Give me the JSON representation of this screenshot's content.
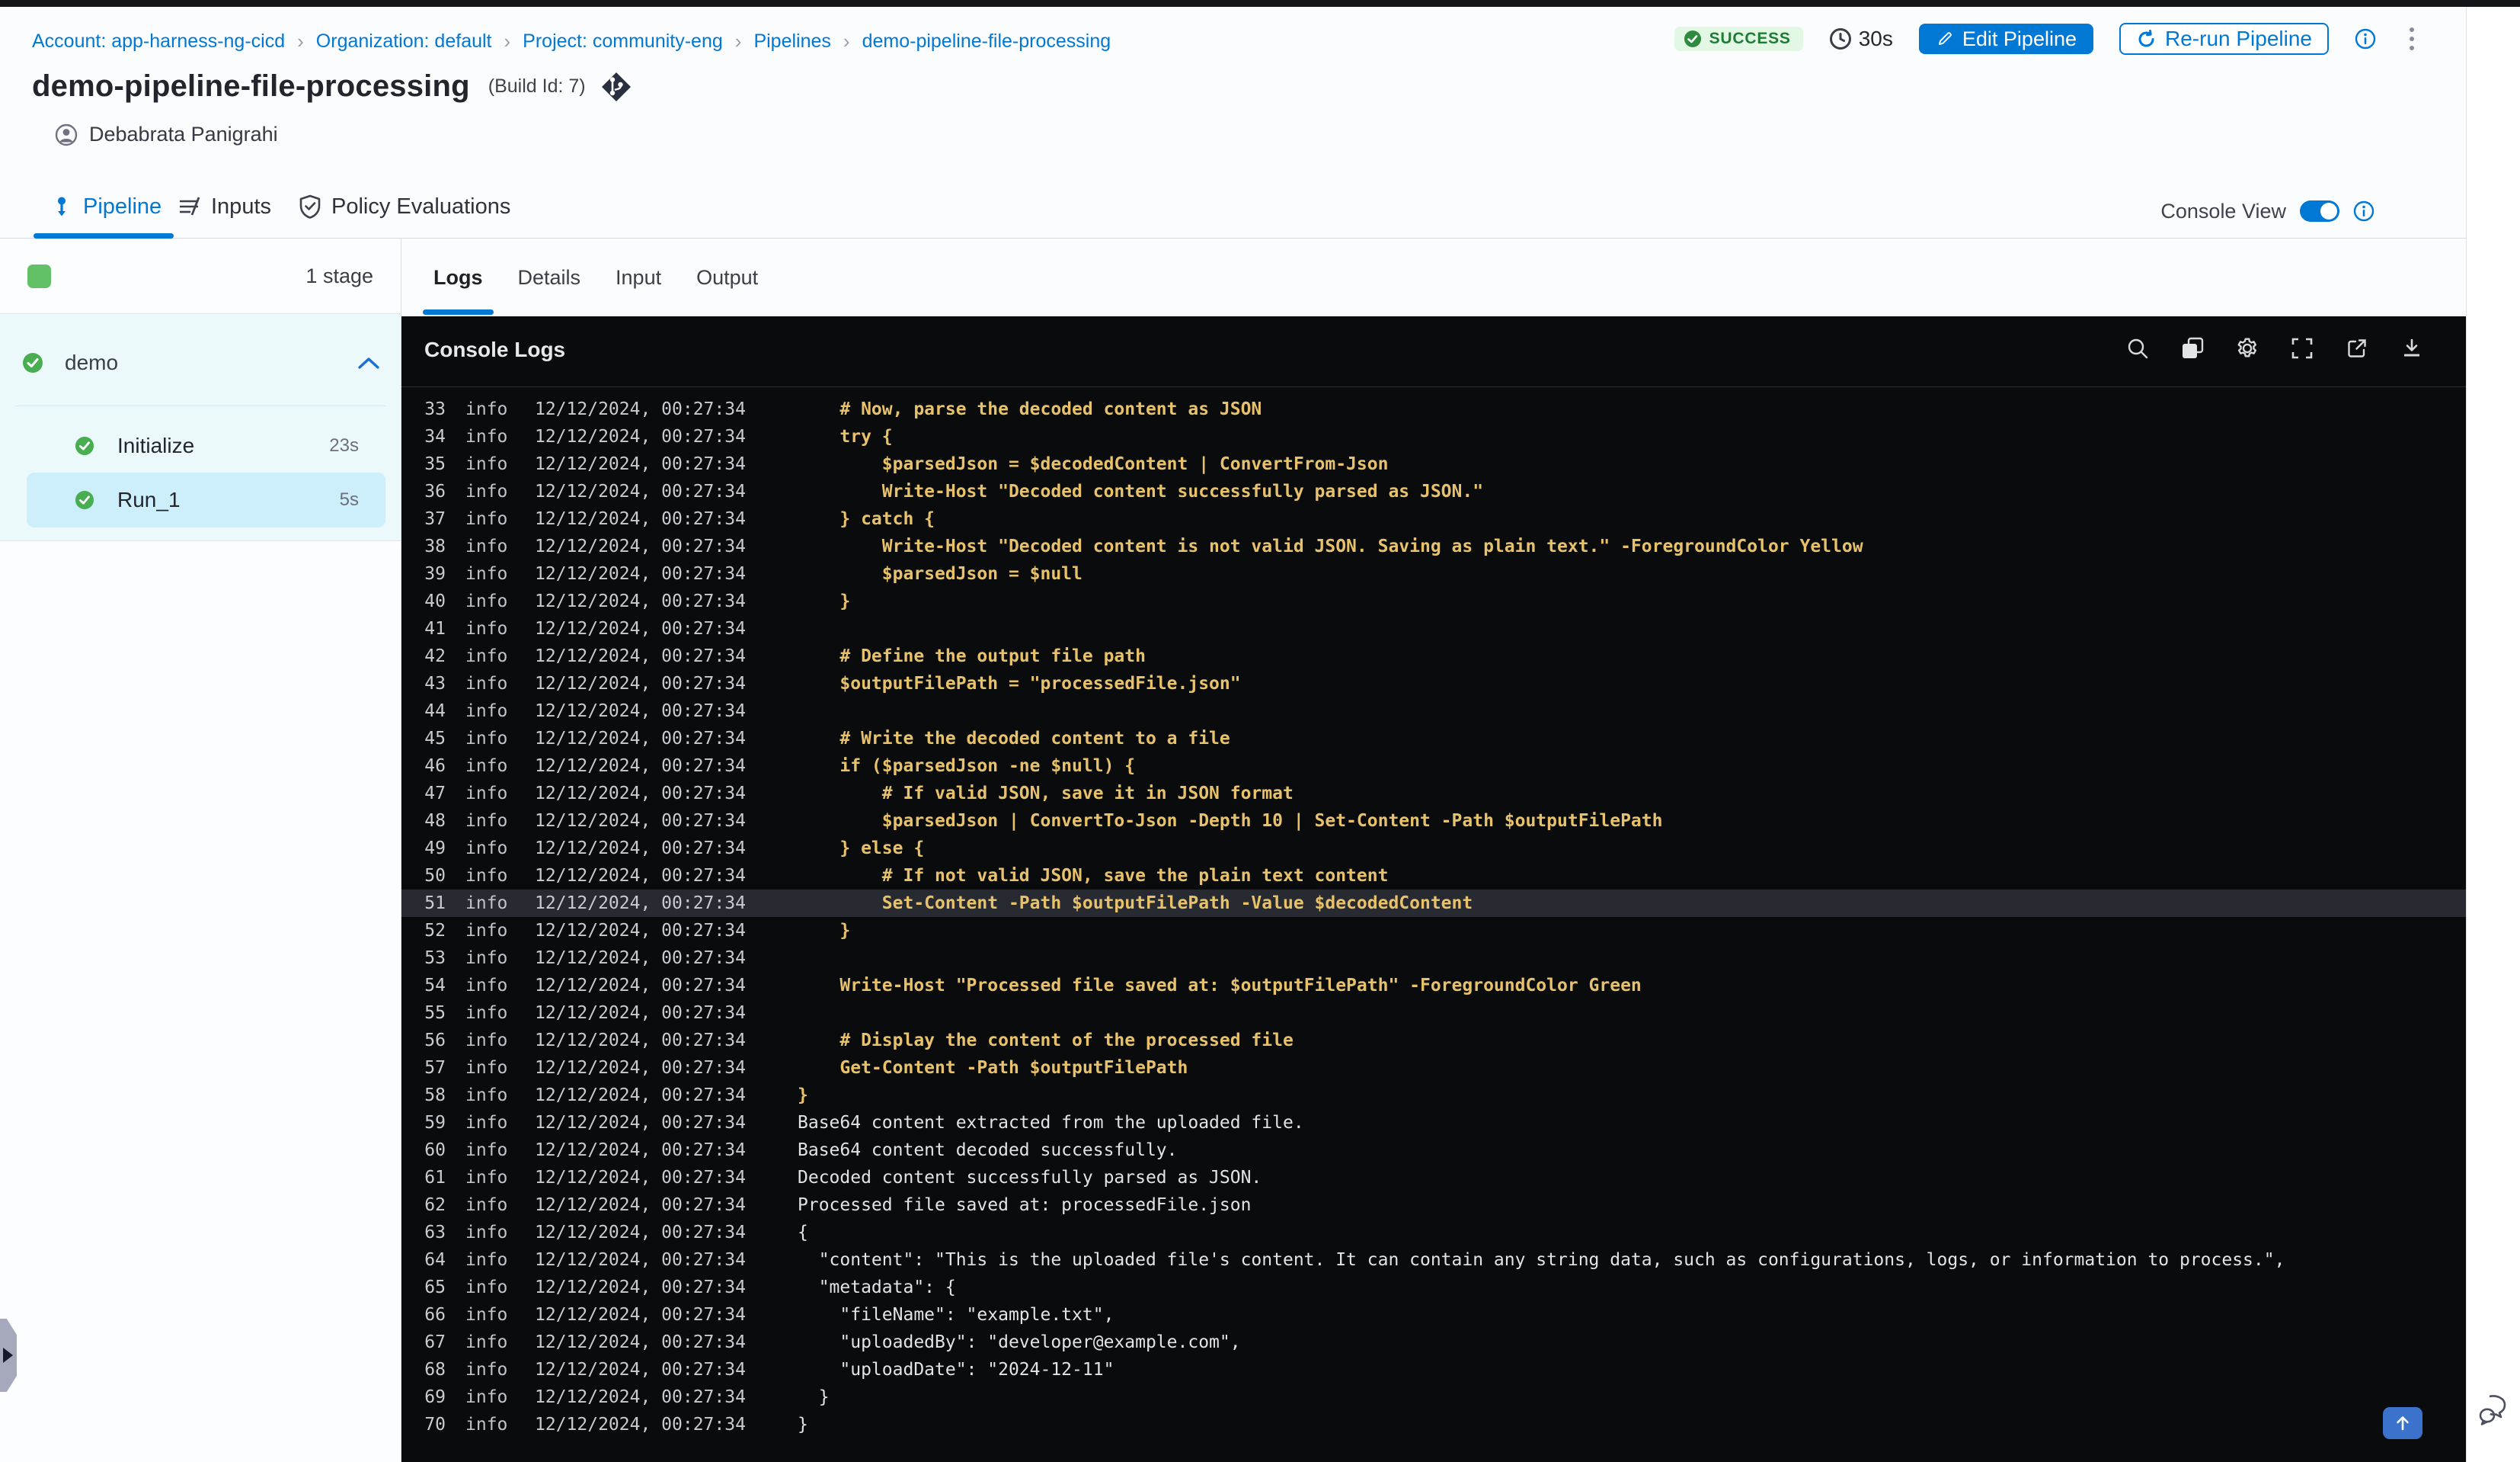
{
  "colors": {
    "accent_blue": "#0278d5",
    "success_green": "#4caf50",
    "badge_bg": "#e3f7e5",
    "badge_text": "#1e7d35",
    "console_bg": "#0a0b0d",
    "log_yellow": "#e8c26a",
    "log_white": "#e2e3e6",
    "stage_group_bg": "#ebf9fb",
    "selected_step_bg": "#cdeefb"
  },
  "breadcrumb": {
    "separator": "›",
    "items": [
      {
        "label": "Account: app-harness-ng-cicd"
      },
      {
        "label": "Organization: default"
      },
      {
        "label": "Project: community-eng"
      },
      {
        "label": "Pipelines"
      },
      {
        "label": "demo-pipeline-file-processing"
      }
    ]
  },
  "header": {
    "title": "demo-pipeline-file-processing",
    "build_id_label": "(Build Id: 7)",
    "author": "Debabrata Panigrahi",
    "status_label": "SUCCESS",
    "duration": "30s",
    "edit_button": "Edit Pipeline",
    "rerun_button": "Re-run Pipeline"
  },
  "main_tabs": [
    {
      "label": "Pipeline",
      "active": true
    },
    {
      "label": "Inputs",
      "active": false
    },
    {
      "label": "Policy Evaluations",
      "active": false
    }
  ],
  "console_view": {
    "label": "Console View",
    "enabled": true
  },
  "stage_panel": {
    "stage_count_label": "1 stage",
    "stage_name": "demo",
    "steps": [
      {
        "name": "Initialize",
        "duration": "23s",
        "status": "success",
        "selected": false
      },
      {
        "name": "Run_1",
        "duration": "5s",
        "status": "success",
        "selected": true
      }
    ]
  },
  "log_tabs": [
    {
      "label": "Logs",
      "active": true
    },
    {
      "label": "Details",
      "active": false
    },
    {
      "label": "Input",
      "active": false
    },
    {
      "label": "Output",
      "active": false
    }
  ],
  "console": {
    "title": "Console Logs",
    "toolbar_icons": [
      "search",
      "copy",
      "settings",
      "fullscreen",
      "open-in-new",
      "download"
    ]
  },
  "log": {
    "level": "info",
    "timestamp": "12/12/2024, 00:27:34",
    "highlight_line": 51,
    "lines": [
      {
        "n": 33,
        "color": "yellow",
        "text": "    # Now, parse the decoded content as JSON"
      },
      {
        "n": 34,
        "color": "yellow",
        "text": "    try {"
      },
      {
        "n": 35,
        "color": "yellow",
        "text": "        $parsedJson = $decodedContent | ConvertFrom-Json"
      },
      {
        "n": 36,
        "color": "yellow",
        "text": "        Write-Host \"Decoded content successfully parsed as JSON.\""
      },
      {
        "n": 37,
        "color": "yellow",
        "text": "    } catch {"
      },
      {
        "n": 38,
        "color": "yellow",
        "text": "        Write-Host \"Decoded content is not valid JSON. Saving as plain text.\" -ForegroundColor Yellow"
      },
      {
        "n": 39,
        "color": "yellow",
        "text": "        $parsedJson = $null"
      },
      {
        "n": 40,
        "color": "yellow",
        "text": "    }"
      },
      {
        "n": 41,
        "color": "yellow",
        "text": ""
      },
      {
        "n": 42,
        "color": "yellow",
        "text": "    # Define the output file path"
      },
      {
        "n": 43,
        "color": "yellow",
        "text": "    $outputFilePath = \"processedFile.json\""
      },
      {
        "n": 44,
        "color": "yellow",
        "text": ""
      },
      {
        "n": 45,
        "color": "yellow",
        "text": "    # Write the decoded content to a file"
      },
      {
        "n": 46,
        "color": "yellow",
        "text": "    if ($parsedJson -ne $null) {"
      },
      {
        "n": 47,
        "color": "yellow",
        "text": "        # If valid JSON, save it in JSON format"
      },
      {
        "n": 48,
        "color": "yellow",
        "text": "        $parsedJson | ConvertTo-Json -Depth 10 | Set-Content -Path $outputFilePath"
      },
      {
        "n": 49,
        "color": "yellow",
        "text": "    } else {"
      },
      {
        "n": 50,
        "color": "yellow",
        "text": "        # If not valid JSON, save the plain text content"
      },
      {
        "n": 51,
        "color": "yellow",
        "text": "        Set-Content -Path $outputFilePath -Value $decodedContent"
      },
      {
        "n": 52,
        "color": "yellow",
        "text": "    }"
      },
      {
        "n": 53,
        "color": "yellow",
        "text": ""
      },
      {
        "n": 54,
        "color": "yellow",
        "text": "    Write-Host \"Processed file saved at: $outputFilePath\" -ForegroundColor Green"
      },
      {
        "n": 55,
        "color": "yellow",
        "text": ""
      },
      {
        "n": 56,
        "color": "yellow",
        "text": "    # Display the content of the processed file"
      },
      {
        "n": 57,
        "color": "yellow",
        "text": "    Get-Content -Path $outputFilePath"
      },
      {
        "n": 58,
        "color": "yellow",
        "text": "}"
      },
      {
        "n": 59,
        "color": "white",
        "text": "Base64 content extracted from the uploaded file."
      },
      {
        "n": 60,
        "color": "white",
        "text": "Base64 content decoded successfully."
      },
      {
        "n": 61,
        "color": "white",
        "text": "Decoded content successfully parsed as JSON."
      },
      {
        "n": 62,
        "color": "white",
        "text": "Processed file saved at: processedFile.json"
      },
      {
        "n": 63,
        "color": "white",
        "text": "{"
      },
      {
        "n": 64,
        "color": "white",
        "text": "  \"content\": \"This is the uploaded file's content. It can contain any string data, such as configurations, logs, or information to process.\","
      },
      {
        "n": 65,
        "color": "white",
        "text": "  \"metadata\": {"
      },
      {
        "n": 66,
        "color": "white",
        "text": "    \"fileName\": \"example.txt\","
      },
      {
        "n": 67,
        "color": "white",
        "text": "    \"uploadedBy\": \"developer@example.com\","
      },
      {
        "n": 68,
        "color": "white",
        "text": "    \"uploadDate\": \"2024-12-11\""
      },
      {
        "n": 69,
        "color": "white",
        "text": "  }"
      },
      {
        "n": 70,
        "color": "white",
        "text": "}"
      }
    ]
  }
}
